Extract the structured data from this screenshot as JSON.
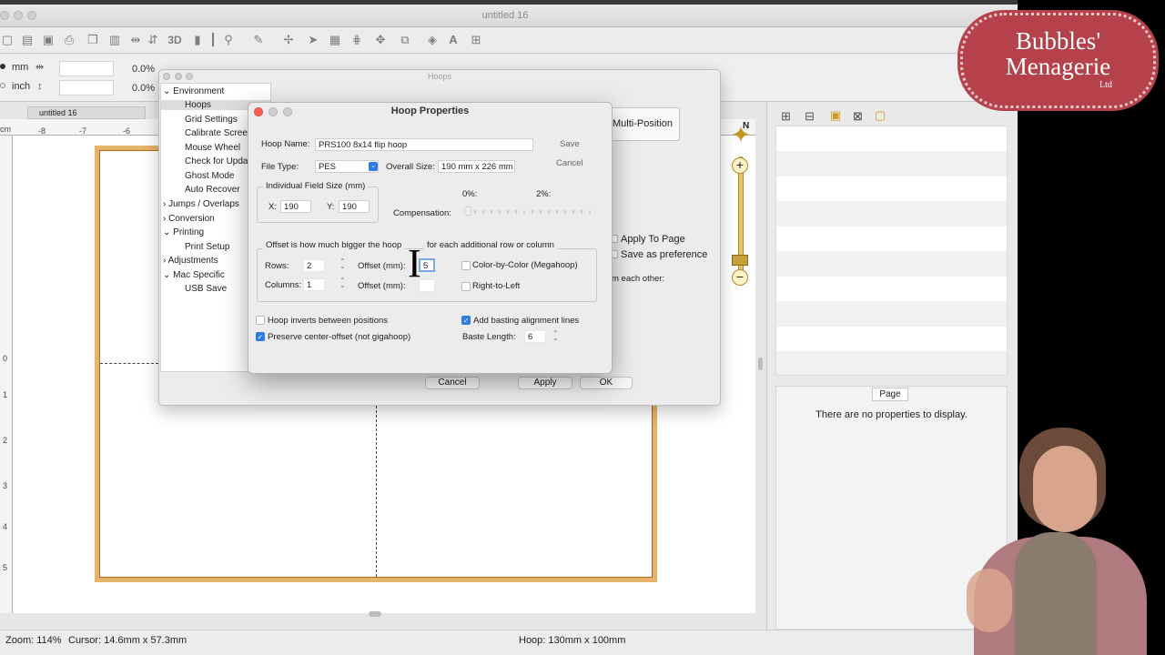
{
  "window": {
    "title": "untitled 16"
  },
  "toolbar": {
    "icons": [
      "new-icon",
      "open-icon",
      "save-icon",
      "print-icon",
      "copy-icon",
      "paste-icon",
      "flip-h-icon",
      "flip-v-icon",
      "3d-icon",
      "chart-icon",
      "ruler-icon",
      "search-icon",
      "measure-icon",
      "compass-icon",
      "pointer-icon",
      "select-icon",
      "layout-icon",
      "move-icon",
      "layers-icon",
      "shapes-icon",
      "text-icon",
      "stitch-icon"
    ],
    "threeD_label": "3D",
    "text_label": "A"
  },
  "units": {
    "mm_label": "mm",
    "inch_label": "inch",
    "scale_x_pct": "0.0%",
    "scale_y_pct": "0.0%"
  },
  "doc_tab": {
    "label": "untitled 16"
  },
  "ruler": {
    "unit": "cm",
    "h_ticks": [
      "-8",
      "-7",
      "-6"
    ],
    "v_ticks": [
      "0",
      "1",
      "2",
      "3",
      "4",
      "5"
    ]
  },
  "hoops_dialog": {
    "title": "Hoops",
    "tree": [
      {
        "label": "Environment",
        "expand": "v",
        "indent": 0
      },
      {
        "label": "Hoops",
        "indent": 1,
        "selected": true
      },
      {
        "label": "Grid Settings",
        "indent": 1
      },
      {
        "label": "Calibrate Screen",
        "indent": 1
      },
      {
        "label": "Mouse Wheel",
        "indent": 1
      },
      {
        "label": "Check for Updat",
        "indent": 1
      },
      {
        "label": "Ghost Mode",
        "indent": 1
      },
      {
        "label": "Auto Recover",
        "indent": 1
      },
      {
        "label": "Jumps / Overlaps",
        "expand": ">",
        "indent": 0
      },
      {
        "label": "Conversion",
        "expand": ">",
        "indent": 0
      },
      {
        "label": "Printing",
        "expand": "v",
        "indent": 0
      },
      {
        "label": "Print Setup",
        "indent": 1
      },
      {
        "label": "Adjustments",
        "expand": ">",
        "indent": 0
      },
      {
        "label": "Mac Specific",
        "expand": "v",
        "indent": 0
      },
      {
        "label": "USB Save",
        "indent": 1
      }
    ],
    "multi_position": "Multi-Position",
    "apply_to_page": "Apply To Page",
    "save_as_pref": "Save as preference",
    "from_each_other": "m each other:",
    "cancel": "Cancel",
    "apply": "Apply",
    "ok": "OK"
  },
  "hoop_props": {
    "title": "Hoop Properties",
    "hoop_name_label": "Hoop Name:",
    "hoop_name_value": "PRS100 8x14 flip hoop",
    "save": "Save",
    "cancel": "Cancel",
    "file_type_label": "File Type:",
    "file_type_value": "PES",
    "overall_size_label": "Overall Size:",
    "overall_size_value": "190 mm x 226 mm",
    "field_size_group": "Individual Field Size (mm)",
    "x_label": "X:",
    "x_value": "190",
    "y_label": "Y:",
    "y_value": "190",
    "pct0": "0%:",
    "pct2": "2%:",
    "compensation_label": "Compensation:",
    "offset_group": "Offset is how much bigger the hoop",
    "offset_group_tail": "for each additional row or column",
    "rows_label": "Rows:",
    "rows_value": "2",
    "columns_label": "Columns:",
    "columns_value": "1",
    "offset_mm_label": "Offset (mm):",
    "offset_row_value": "5",
    "offset_col_value": "",
    "color_by_color": "Color-by-Color (Megahoop)",
    "right_to_left": "Right-to-Left",
    "hoop_inverts": "Hoop inverts between positions",
    "preserve_center": "Preserve center-offset (not gigahoop)",
    "add_basting": "Add basting alignment lines",
    "baste_length_label": "Baste Length:",
    "baste_length_value": "6"
  },
  "right_panel": {
    "page_tab": "Page",
    "no_props": "There are no properties to display.",
    "icons": [
      "group-icon",
      "ungroup-icon",
      "lock-icon",
      "unlock-all-icon",
      "lock-open-icon"
    ]
  },
  "status": {
    "zoom": "Zoom: 114%",
    "cursor": "Cursor: 14.6mm x 57.3mm",
    "hoop": "Hoop: 130mm x 100mm"
  },
  "logo": {
    "line1": "Bubbles'",
    "line2": "Menagerie",
    "line3": "Ltd"
  },
  "colors": {
    "hoop_frame": "#e6b36a",
    "logo_bg": "#b5414b",
    "check_blue": "#2d7be5",
    "slider_gold": "#e8c45c"
  }
}
